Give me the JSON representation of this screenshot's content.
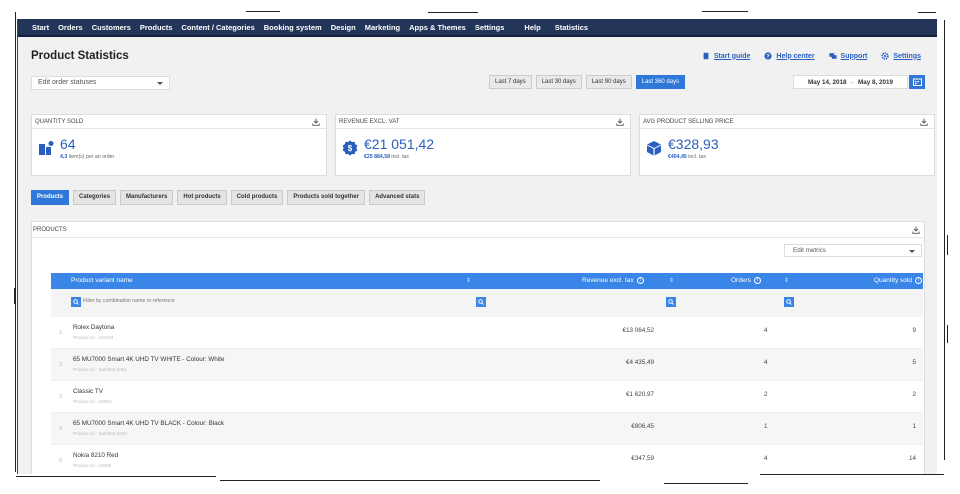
{
  "nav": [
    "Start",
    "Orders",
    "Customers",
    "Products",
    "Content / Categories",
    "Booking system",
    "Design",
    "Marketing",
    "Apps & Themes",
    "Settings",
    "Help",
    "Statistics"
  ],
  "page": {
    "title": "Product Statistics"
  },
  "help_links": {
    "start_guide": "Start guide",
    "help_center": "Help center",
    "support": "Support",
    "settings": "Settings"
  },
  "order_status_select": "Edit order statuses",
  "ranges": [
    "Last 7 days",
    "Last 30 days",
    "Last 90 days",
    "Last 360 days"
  ],
  "active_range": "Last 360 days",
  "date_range": {
    "from": "May 14, 2018",
    "separator": "–",
    "to": "May 8, 2019"
  },
  "kpis": {
    "quantity": {
      "title": "Quantity sold",
      "value": "64",
      "sub_value": "4,3",
      "sub_text": "item(s) per an order"
    },
    "revenue": {
      "title": "Revenue excl. VAT",
      "value": "€21 051,42",
      "sub_value": "€25 884,58",
      "sub_text": "incl. tax"
    },
    "avg_price": {
      "title": "Avg product selling price",
      "value": "€328,93",
      "sub_value": "€404,45",
      "sub_text": "incl. tax"
    }
  },
  "tabs": [
    "Products",
    "Categories",
    "Manufacturers",
    "Hot products",
    "Cold products",
    "Products sold together",
    "Advanced stats"
  ],
  "active_tab": "Products",
  "panel": {
    "title": "PRODUCTS",
    "metrics_select": "Edit metrics",
    "columns": {
      "name": "Product variant name",
      "revenue": "Revenue excl. tax",
      "orders": "Orders",
      "quantity": "Quantity sold"
    },
    "filter_placeholder": "Filter by combination name or reference",
    "rows": [
      {
        "num": "1.",
        "name": "Rolex Daytona",
        "ref": "Product no.: 234234",
        "revenue": "€13 064,52",
        "orders": "4",
        "qty": "9"
      },
      {
        "num": "2.",
        "name": "65 MU7000 Smart 4K UHD TV WHITE - Colour: White",
        "ref": "Product no.: Sam001-0001",
        "revenue": "€4 435,49",
        "orders": "4",
        "qty": "5"
      },
      {
        "num": "3.",
        "name": "Classic TV",
        "ref": "Product no.: tv0001",
        "revenue": "€1 620,97",
        "orders": "2",
        "qty": "2"
      },
      {
        "num": "4.",
        "name": "65 MU7000 Smart 4K UHD TV BLACK - Colour: Black",
        "ref": "Product no.: Sam001-0002",
        "revenue": "€806,45",
        "orders": "1",
        "qty": "1"
      },
      {
        "num": "5.",
        "name": "Nokia 8210 Red",
        "ref": "Product no.: 10008",
        "revenue": "€347,59",
        "orders": "4",
        "qty": "14"
      }
    ]
  },
  "colors": {
    "nav_bg": "#23365a",
    "accent": "#2f78d9",
    "table_head": "#3a86e8",
    "link": "#2a5fbf"
  }
}
